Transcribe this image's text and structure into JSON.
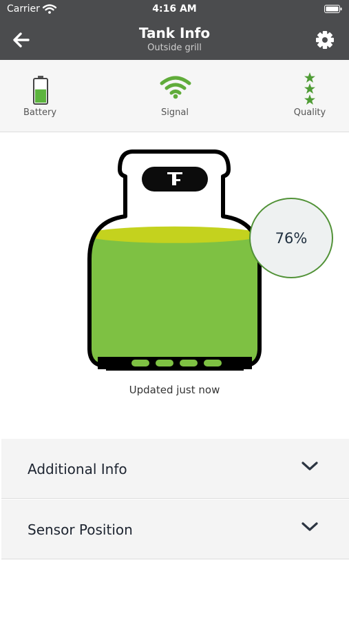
{
  "status_bar": {
    "carrier": "Carrier",
    "time": "4:16 AM"
  },
  "nav": {
    "title": "Tank Info",
    "subtitle": "Outside grill",
    "back_icon": "arrow-left-icon",
    "settings_icon": "gear-icon"
  },
  "indicators": {
    "battery": {
      "label": "Battery",
      "icon": "battery-icon",
      "level_fraction": 0.55
    },
    "signal": {
      "label": "Signal",
      "icon": "wifi-icon"
    },
    "quality": {
      "label": "Quality",
      "icon": "star-icon",
      "stars": 3
    }
  },
  "tank": {
    "level_text": "76%",
    "level_percent": 76,
    "updated_text": "Updated just now"
  },
  "sections": [
    {
      "label": "Additional Info",
      "icon": "chevron-down-icon"
    },
    {
      "label": "Sensor Position",
      "icon": "chevron-down-icon"
    }
  ],
  "colors": {
    "header": "#4b4c4e",
    "accent_green": "#519237",
    "tank_fill": "#7ec143",
    "tank_fill_top": "#c4d21e"
  }
}
